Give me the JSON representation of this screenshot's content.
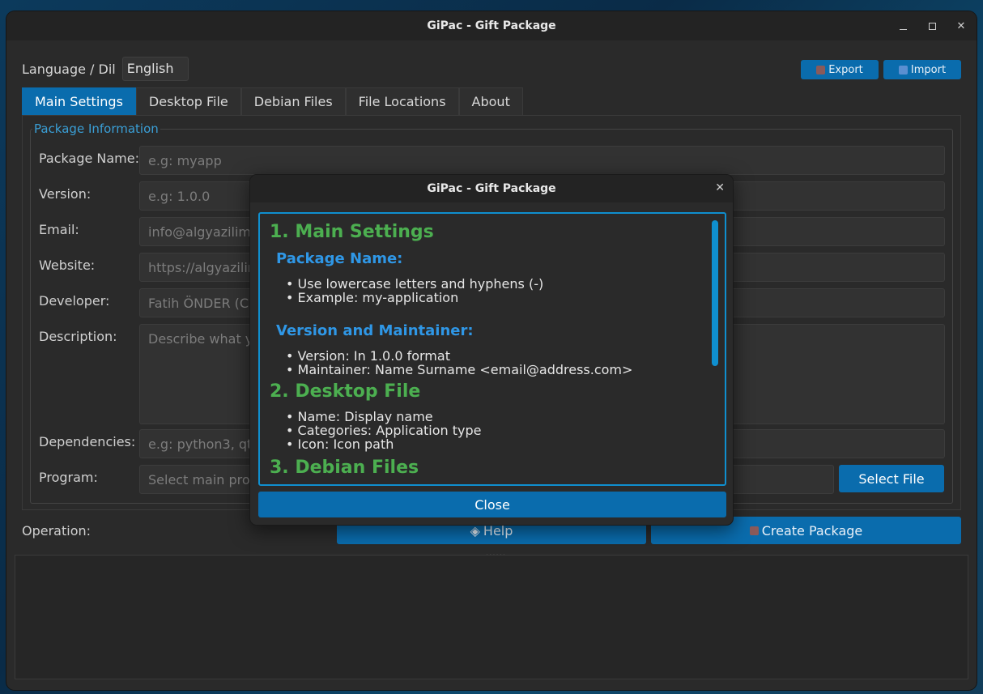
{
  "window": {
    "title": "GiPac - Gift Package"
  },
  "language": {
    "label": "Language / Dil",
    "value": "English"
  },
  "toolbar": {
    "export_label": "Export",
    "import_label": "Import"
  },
  "tabs": [
    {
      "label": "Main Settings",
      "active": true
    },
    {
      "label": "Desktop File"
    },
    {
      "label": "Debian Files"
    },
    {
      "label": "File Locations"
    },
    {
      "label": "About"
    }
  ],
  "package_info": {
    "title": "Package Information",
    "fields": {
      "package_name": {
        "label": "Package Name:",
        "placeholder": "e.g: myapp"
      },
      "version": {
        "label": "Version:",
        "placeholder": "e.g: 1.0.0"
      },
      "email": {
        "label": "Email:",
        "placeholder": "info@algyazilim.c"
      },
      "website": {
        "label": "Website:",
        "placeholder": "https://algyazilim"
      },
      "developer": {
        "label": "Developer:",
        "placeholder": "Fatih ÖNDER (Ce"
      },
      "description": {
        "label": "Description:",
        "placeholder": "Describe what yo"
      },
      "dependencies": {
        "label": "Dependencies:",
        "placeholder": "e.g: python3, qt5"
      },
      "program": {
        "label": "Program:",
        "placeholder": "Select main prog"
      }
    },
    "select_file_label": "Select File"
  },
  "operation": {
    "label": "Operation:",
    "help_label": "Help",
    "create_label": "Create Package"
  },
  "splitter": {
    "label": "......"
  },
  "dialog": {
    "title": "GiPac - Gift Package",
    "close_label": "Close",
    "sections": {
      "main_settings": "1. Main Settings",
      "package_name_heading": "Package Name:",
      "package_name_items": [
        "Use lowercase letters and hyphens (-)",
        "Example: my-application"
      ],
      "version_heading": "Version and Maintainer:",
      "version_items": [
        "Version: In 1.0.0 format",
        "Maintainer: Name Surname <email@address.com>"
      ],
      "desktop_file": "2. Desktop File",
      "desktop_items": [
        "Name: Display name",
        "Categories: Application type",
        "Icon: Icon path"
      ],
      "debian_files": "3. Debian Files"
    }
  },
  "colors": {
    "accent": "#0a6cad",
    "heading_green": "#4caf50",
    "heading_blue": "#2f97e6",
    "group_title": "#3a9fd6"
  }
}
